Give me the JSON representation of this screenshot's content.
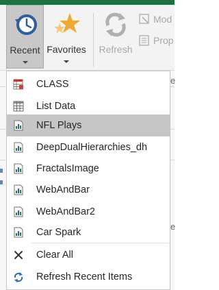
{
  "ribbon": {
    "buttons": [
      {
        "label": "Recent"
      },
      {
        "label": "Favorites"
      },
      {
        "label": "Refresh"
      }
    ],
    "small_buttons": [
      {
        "label": "Mod"
      },
      {
        "label": "Prop"
      }
    ]
  },
  "peek": {
    "upper": "e",
    "lower": "e"
  },
  "menu": {
    "recent_items": [
      {
        "label": "CLASS",
        "icon": "table-icon-red"
      },
      {
        "label": "List Data",
        "icon": "grid-icon"
      },
      {
        "label": "NFL Plays",
        "icon": "report-icon"
      },
      {
        "label": "DeepDualHierarchies_dh",
        "icon": "report-icon"
      },
      {
        "label": "FractalsImage",
        "icon": "report-icon"
      },
      {
        "label": "WebAndBar",
        "icon": "report-icon"
      },
      {
        "label": "WebAndBar2",
        "icon": "report-icon"
      },
      {
        "label": "Car Spark",
        "icon": "report-icon"
      }
    ],
    "actions": [
      {
        "label": "Clear All",
        "icon": "close-icon"
      },
      {
        "label": "Refresh Recent Items",
        "icon": "refresh-icon"
      }
    ],
    "highlighted_item": "NFL Plays"
  },
  "colors": {
    "accent_green": "#1e7145",
    "highlight": "#c6c6c6",
    "clock_blue": "#2d5f9f",
    "star_orange": "#f0a830",
    "refresh_blue": "#2b6cb5"
  }
}
